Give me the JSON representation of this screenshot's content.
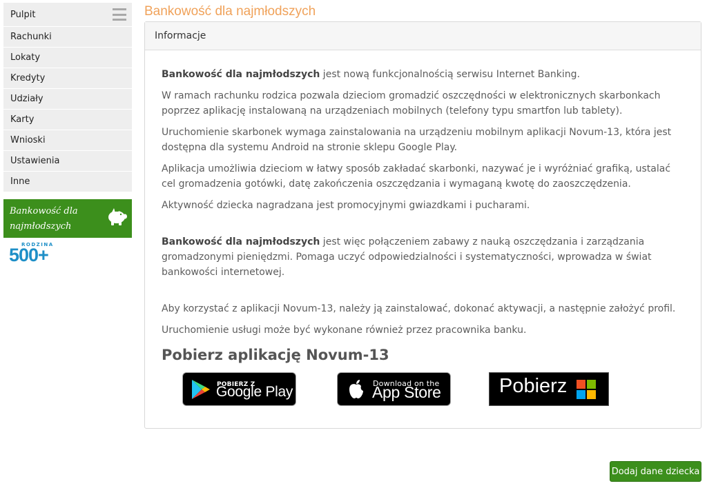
{
  "sidebar": {
    "items": [
      {
        "label": "Pulpit"
      },
      {
        "label": "Rachunki"
      },
      {
        "label": "Lokaty"
      },
      {
        "label": "Kredyty"
      },
      {
        "label": "Udziały"
      },
      {
        "label": "Karty"
      },
      {
        "label": "Wnioski"
      },
      {
        "label": "Ustawienia"
      },
      {
        "label": "Inne"
      }
    ],
    "menu_icon": "hamburger-icon",
    "kids_banner": {
      "label": "Bankowość dla najmłodszych",
      "icon": "piggy-bank-icon"
    },
    "logo_500": {
      "top": "RODZINA",
      "number": "500+"
    }
  },
  "page": {
    "title": "Bankowość dla najmłodszych"
  },
  "panel": {
    "heading": "Informacje",
    "p1": {
      "bold": "Bankowość dla najmłodszych",
      "rest": " jest nową funkcjonalnością serwisu Internet Banking."
    },
    "p2": "W ramach rachunku rodzica pozwala dzieciom gromadzić oszczędności w elektronicznych skarbonkach poprzez aplikację instalowaną na urządzeniach mobilnych (telefony typu smartfon lub tablety).",
    "p3": "Uruchomienie skarbonek wymaga zainstalowania na urządzeniu mobilnym aplikacji Novum-13, która jest dostępna dla systemu Android na stronie sklepu Google Play.",
    "p4": "Aplikacja umożliwia dzieciom w łatwy sposób zakładać skarbonki, nazywać je i wyróżniać grafiką, ustalać cel gromadzenia gotówki, datę zakończenia oszczędzania i wymaganą kwotę do zaoszczędzenia.",
    "p5": "Aktywność dziecka nagradzana jest promocyjnymi gwiazdkami i pucharami.",
    "p6": {
      "bold": "Bankowość dla najmłodszych",
      "rest": " jest więc połączeniem zabawy z nauką oszczędzania i zarządzania gromadzonymi pieniędzmi. Pomaga uczyć odpowiedzialności i systematyczności, wprowadza w świat bankowości internetowej."
    },
    "p7": "Aby korzystać z aplikacji Novum-13, należy ją zainstalować, dokonać aktywacji, a następnie założyć profil.",
    "p8": "Uruchomienie usługi może być wykonane również przez pracownika banku.",
    "download_title": "Pobierz aplikację Novum-13",
    "badges": {
      "google": {
        "small": "POBIERZ Z",
        "big": "Google Play",
        "icon": "google-play-icon"
      },
      "apple": {
        "small": "Download on the",
        "big": "App Store",
        "icon": "apple-icon"
      },
      "microsoft": {
        "big": "Pobierz",
        "icon": "windows-icon"
      }
    }
  },
  "actions": {
    "add_child": "Dodaj dane dziecka"
  },
  "colors": {
    "accent_green": "#3c8f1c",
    "title_orange": "#f0a25a",
    "logo_blue": "#1e8fc7"
  }
}
